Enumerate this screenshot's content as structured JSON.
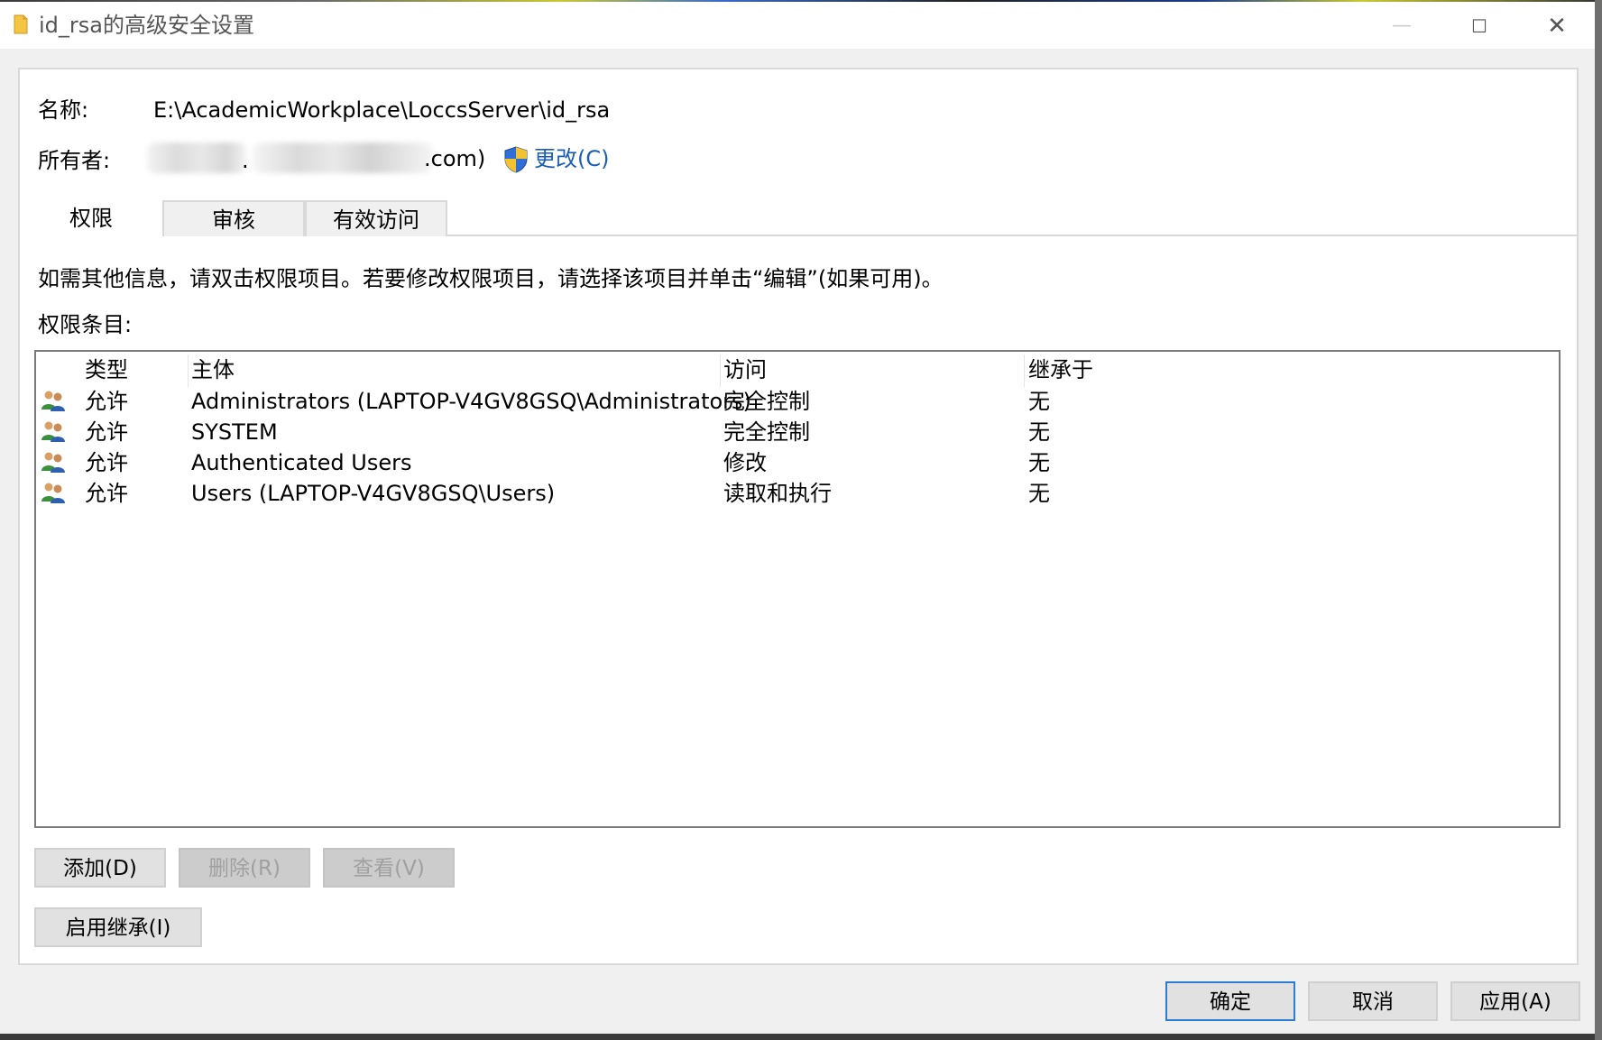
{
  "window": {
    "title": "id_rsa的高级安全设置",
    "minimize_glyph": "—",
    "maximize_glyph": "☐",
    "close_glyph": "✕"
  },
  "header": {
    "name_label": "名称:",
    "name_value": "E:\\AcademicWorkplace\\LoccsServer\\id_rsa",
    "owner_label": "所有者:",
    "owner_separator": ".",
    "owner_suffix": ".com)",
    "change_link": "更改(C)"
  },
  "tabs": [
    {
      "label": "权限",
      "active": true
    },
    {
      "label": "审核",
      "active": false
    },
    {
      "label": "有效访问",
      "active": false
    }
  ],
  "info_text": "如需其他信息，请双击权限项目。若要修改权限项目，请选择该项目并单击“编辑”(如果可用)。",
  "entries_label": "权限条目:",
  "table": {
    "columns": [
      "类型",
      "主体",
      "访问",
      "继承于"
    ],
    "rows": [
      {
        "icon": "users-icon",
        "type": "允许",
        "principal": "Administrators (LAPTOP-V4GV8GSQ\\Administrators)",
        "access": "完全控制",
        "inherited": "无"
      },
      {
        "icon": "users-icon",
        "type": "允许",
        "principal": "SYSTEM",
        "access": "完全控制",
        "inherited": "无"
      },
      {
        "icon": "users-icon",
        "type": "允许",
        "principal": "Authenticated Users",
        "access": "修改",
        "inherited": "无"
      },
      {
        "icon": "users-icon",
        "type": "允许",
        "principal": "Users (LAPTOP-V4GV8GSQ\\Users)",
        "access": "读取和执行",
        "inherited": "无"
      }
    ]
  },
  "buttons": {
    "add": "添加(D)",
    "remove": "删除(R)",
    "view": "查看(V)",
    "enable_inheritance": "启用继承(I)",
    "ok": "确定",
    "cancel": "取消",
    "apply": "应用(A)"
  },
  "colors": {
    "link": "#1a5fb4",
    "default_button_border": "#2b7cd3",
    "dialog_background": "#f0f0f0"
  }
}
